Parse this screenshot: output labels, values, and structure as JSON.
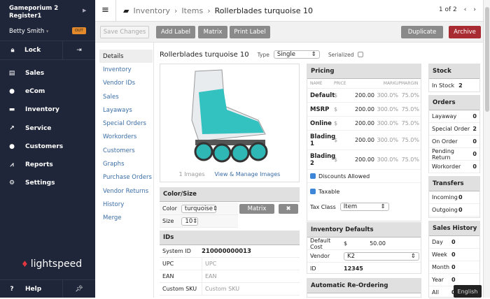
{
  "sidebar": {
    "store": "Gameporium 2",
    "register": "Register1",
    "user": "Betty Smith",
    "out_badge": "OUT",
    "lock": "Lock",
    "items": [
      {
        "label": "Sales",
        "icon": "register-icon"
      },
      {
        "label": "eCom",
        "icon": "globe-icon"
      },
      {
        "label": "Inventory",
        "icon": "box-icon"
      },
      {
        "label": "Service",
        "icon": "hammer-icon"
      },
      {
        "label": "Customers",
        "icon": "user-icon"
      },
      {
        "label": "Reports",
        "icon": "chart-icon"
      },
      {
        "label": "Settings",
        "icon": "gear-icon"
      }
    ],
    "logo": "lightspeed",
    "help": "Help"
  },
  "header": {
    "crumbs": [
      "Inventory",
      "Items",
      "Rollerblades turquoise 10"
    ],
    "pager": "1 of 2"
  },
  "toolbar": {
    "save": "Save Changes",
    "add_label": "Add Label",
    "matrix": "Matrix",
    "print_label": "Print Label",
    "duplicate": "Duplicate",
    "archive": "Archive"
  },
  "leftnav": [
    "Details",
    "Inventory",
    "Vendor IDs",
    "Sales",
    "Layaways",
    "Special Orders",
    "Workorders",
    "Customers",
    "Graphs",
    "Purchase Orders",
    "Vendor Returns",
    "History",
    "Merge"
  ],
  "item": {
    "title": "Rollerblades turquoise 10",
    "type_label": "Type",
    "type": "Single",
    "serialized_label": "Serialized",
    "images_count": "1 Images",
    "manage_images": "View & Manage Images"
  },
  "colorsize": {
    "title": "Color/Size",
    "color_label": "Color",
    "color": "turquoise",
    "size_label": "Size",
    "size": "10",
    "matrix": "Matrix",
    "remove": "✖"
  },
  "ids": {
    "title": "IDs",
    "rows": [
      {
        "label": "System ID",
        "value": "210000000013",
        "placeholder": ""
      },
      {
        "label": "UPC",
        "value": "",
        "placeholder": "UPC"
      },
      {
        "label": "EAN",
        "value": "",
        "placeholder": "EAN"
      },
      {
        "label": "Custom SKU",
        "value": "",
        "placeholder": "Custom SKU"
      }
    ]
  },
  "pricing": {
    "title": "Pricing",
    "headers": [
      "NAME",
      "PRICE",
      "MARKUP",
      "MARGIN"
    ],
    "rows": [
      {
        "name": "Default",
        "cur": "$",
        "price": "200.00",
        "markup": "300.0%",
        "margin": "75.0%"
      },
      {
        "name": "MSRP",
        "cur": "$",
        "price": "200.00",
        "markup": "300.0%",
        "margin": "75.0%"
      },
      {
        "name": "Online",
        "cur": "$",
        "price": "200.00",
        "markup": "300.0%",
        "margin": "75.0%"
      },
      {
        "name": "Blading 1",
        "cur": "$",
        "price": "200.00",
        "markup": "300.0%",
        "margin": "75.0%"
      },
      {
        "name": "Blading 2",
        "cur": "$",
        "price": "200.00",
        "markup": "300.0%",
        "margin": "75.0%"
      }
    ],
    "discounts": "Discounts Allowed",
    "taxable": "Taxable",
    "tax_class_label": "Tax Class",
    "tax_class": "Item"
  },
  "inv_defaults": {
    "title": "Inventory Defaults",
    "cost_label": "Default Cost",
    "cur": "$",
    "cost": "50.00",
    "vendor_label": "Vendor",
    "vendor": "K2",
    "id_label": "ID",
    "id": "12345"
  },
  "reorder": {
    "title": "Automatic Re-Ordering"
  },
  "stock": {
    "title": "Stock",
    "label": "In Stock",
    "value": "2"
  },
  "orders": {
    "title": "Orders",
    "rows": [
      {
        "label": "Layaway",
        "value": "0"
      },
      {
        "label": "Special Order",
        "value": "2"
      },
      {
        "label": "On Order",
        "value": "0"
      },
      {
        "label": "Pending Return",
        "value": "0"
      },
      {
        "label": "Workorder",
        "value": "0"
      }
    ]
  },
  "transfers": {
    "title": "Transfers",
    "rows": [
      {
        "label": "Incoming",
        "value": "0"
      },
      {
        "label": "Outgoing",
        "value": "0"
      }
    ]
  },
  "sales_history": {
    "title": "Sales History",
    "rows": [
      {
        "label": "Day",
        "value": "0"
      },
      {
        "label": "Week",
        "value": "0"
      },
      {
        "label": "Month",
        "value": "0"
      },
      {
        "label": "Year",
        "value": "0"
      },
      {
        "label": "All",
        "value": "0"
      }
    ]
  },
  "language": "English"
}
